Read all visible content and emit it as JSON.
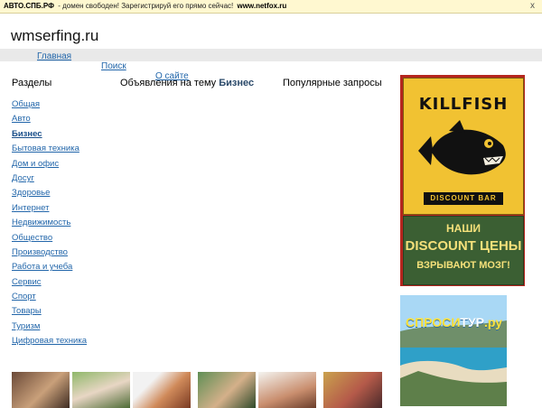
{
  "topbar": {
    "lead": "АВТО.СПБ.РФ",
    "middle": "- домен свободен! Зарегистрируй его прямо сейчас!",
    "link": "www.netfox.ru",
    "close": "x"
  },
  "site": {
    "title": "wmserfing.ru"
  },
  "nav": {
    "home": "Главная",
    "search": "Поиск",
    "about": "О сайте"
  },
  "columns": {
    "sections": "Разделы",
    "ads_prefix": "Объявления на тему",
    "ads_topic": "Бизнес",
    "popular": "Популярные запросы"
  },
  "categories": [
    "Общая",
    "Авто",
    "Бизнес",
    "Бытовая техника",
    "Дом и офис",
    "Досуг",
    "Здоровье",
    "Интернет",
    "Недвижимость",
    "Общество",
    "Производство",
    "Работа и учеба",
    "Сервис",
    "Спорт",
    "Товары",
    "Туризм",
    "Цифровая техника"
  ],
  "active_category": "Бизнес",
  "ads": {
    "killfish": {
      "logo": "KILLFISH",
      "sub": "DISCOUNT BAR",
      "line1": "НАШИ",
      "line2": "DISCOUNT ЦЕНЫ",
      "line3": "ВЗРЫВАЮТ МОЗГ!"
    },
    "tour": {
      "logo_a": "СПРОСИ",
      "logo_b": "ТУР",
      "logo_c": ".ру"
    }
  },
  "colors": {
    "link": "#2266aa",
    "topbar_bg": "#fff8d0",
    "killfish_red": "#b5261e",
    "killfish_yellow": "#f1c232",
    "killfish_green": "#3b5f33"
  }
}
